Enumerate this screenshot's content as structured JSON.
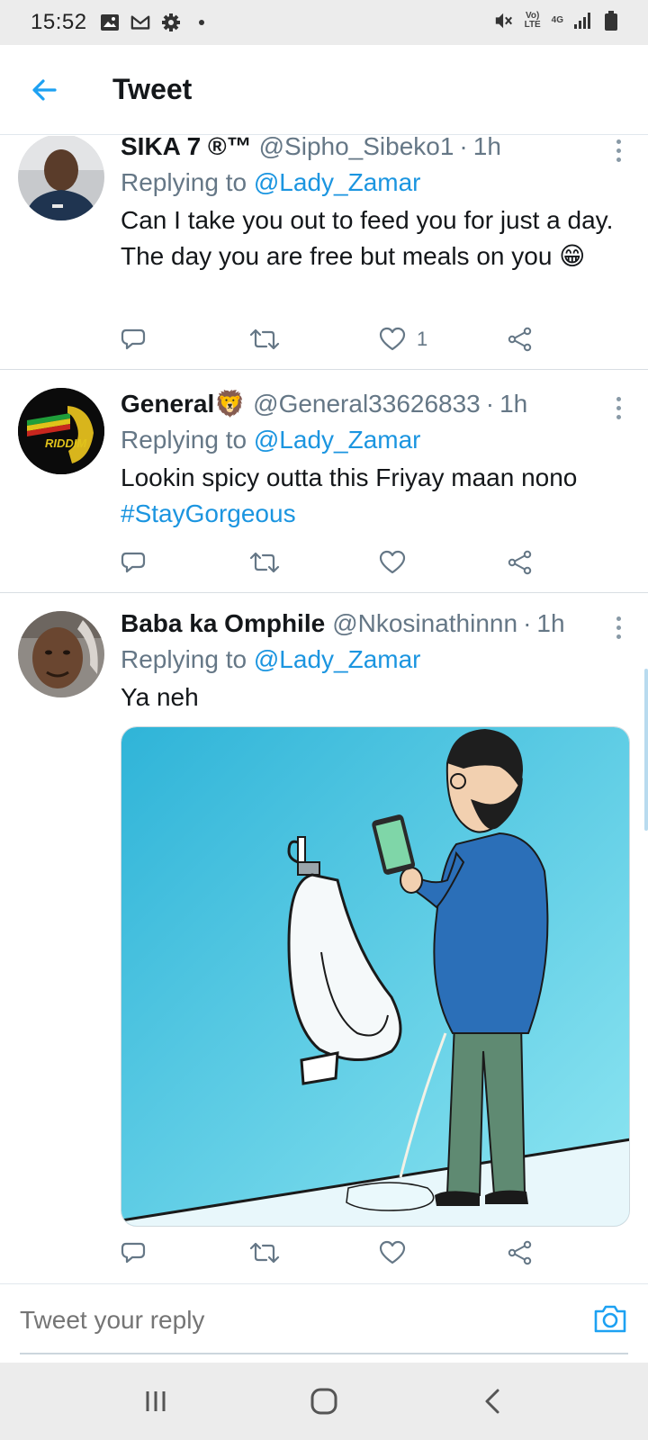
{
  "status_bar": {
    "time": "15:52",
    "left_icons": [
      "image-icon",
      "gmail-icon",
      "gear-icon",
      "dot-icon"
    ],
    "volte": "Vo) LTE",
    "network": "4G",
    "right_icons": [
      "mute-icon",
      "signal-icon",
      "battery-icon"
    ]
  },
  "header": {
    "title": "Tweet",
    "back_icon": "back-arrow-icon"
  },
  "tweets": [
    {
      "display_name": "SIKA 7 ®™",
      "handle": "@Sipho_Sibeko1",
      "dot": "·",
      "time": "1h",
      "replying_to_label": "Replying to",
      "replying_to": "@Lady_Zamar",
      "text": "Can I take you out to feed you for just a day. The day you are free but meals on you 😁",
      "like_count": "1"
    },
    {
      "display_name": "General🦁",
      "handle": "@General33626833",
      "dot": "·",
      "time": "1h",
      "replying_to_label": "Replying to",
      "replying_to": "@Lady_Zamar",
      "text": "Lookin spicy outta this Friyay maan nono",
      "hashtag": "#StayGorgeous",
      "avatar_label": "RIDDIM",
      "like_count": ""
    },
    {
      "display_name": "Baba ka Omphile",
      "handle": "@Nkosinathinnn",
      "dot": "·",
      "time": "1h",
      "replying_to_label": "Replying to",
      "replying_to": "@Lady_Zamar",
      "text": "Ya neh",
      "like_count": ""
    }
  ],
  "composer": {
    "placeholder": "Tweet your reply",
    "camera_icon": "camera-icon"
  },
  "nav": {
    "icons": [
      "recent-apps-icon",
      "home-icon",
      "back-icon"
    ]
  },
  "colors": {
    "accent": "#1da1f2",
    "link": "#1b95e0",
    "secondary_text": "#657786",
    "system_bar": "#ececec"
  }
}
